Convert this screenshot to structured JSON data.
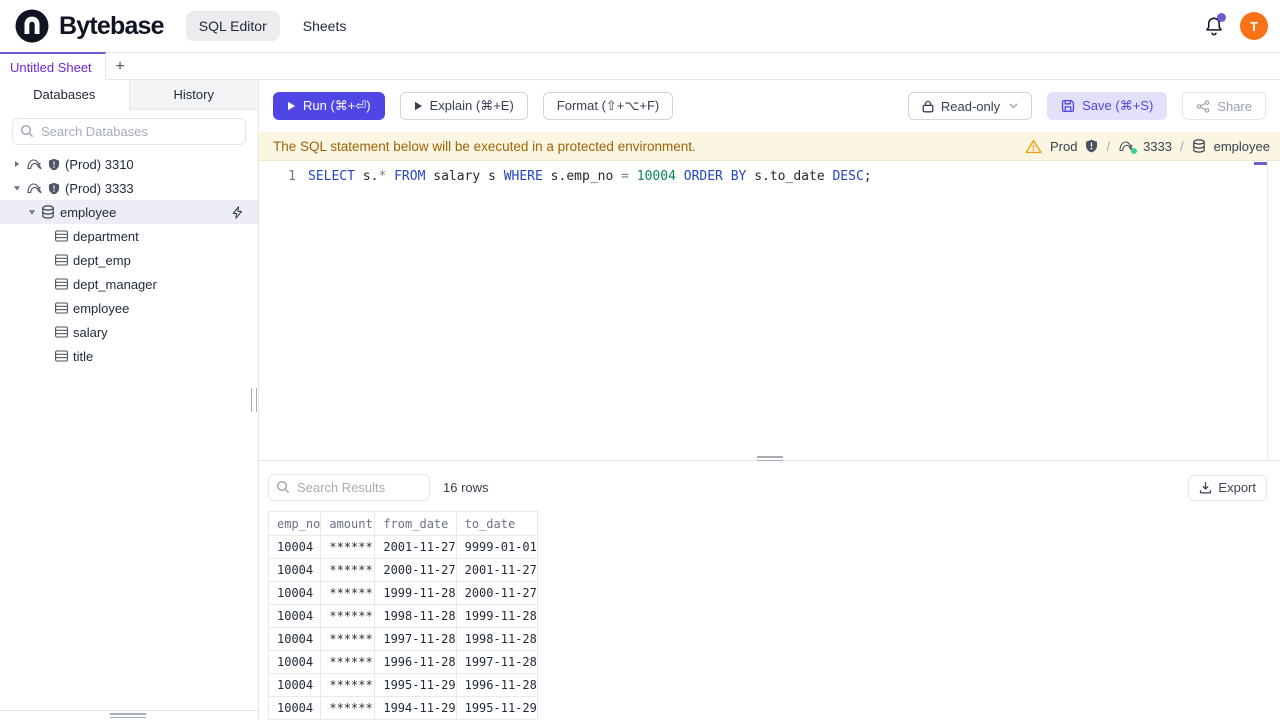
{
  "header": {
    "brand": "Bytebase",
    "tabs": [
      {
        "label": "SQL Editor",
        "active": true
      },
      {
        "label": "Sheets",
        "active": false
      }
    ],
    "avatar": "T"
  },
  "sheet_bar": {
    "active_tab": "Untitled Sheet",
    "add_button": "+"
  },
  "sidebar": {
    "tabs": [
      {
        "label": "Databases",
        "active": true
      },
      {
        "label": "History",
        "active": false
      }
    ],
    "search_placeholder": "Search Databases",
    "tree": [
      {
        "kind": "instance",
        "label": "(Prod) 3310",
        "caret": "collapsed"
      },
      {
        "kind": "instance",
        "label": "(Prod) 3333",
        "caret": "expanded"
      },
      {
        "kind": "database",
        "label": "employee",
        "caret": "expanded",
        "selected": true,
        "action_icon": "lightning-icon"
      },
      {
        "kind": "table",
        "label": "department"
      },
      {
        "kind": "table",
        "label": "dept_emp"
      },
      {
        "kind": "table",
        "label": "dept_manager"
      },
      {
        "kind": "table",
        "label": "employee"
      },
      {
        "kind": "table",
        "label": "salary"
      },
      {
        "kind": "table",
        "label": "title"
      }
    ]
  },
  "toolbar": {
    "run": "Run (⌘+⏎)",
    "explain": "Explain (⌘+E)",
    "format": "Format (⇧+⌥+F)",
    "readonly": "Read-only",
    "save": "Save (⌘+S)",
    "share": "Share"
  },
  "banner": {
    "message": "The SQL statement below will be executed in a protected environment.",
    "environment": "Prod",
    "separator": "/",
    "instance": "3333",
    "database": "employee"
  },
  "editor": {
    "line_number": "1",
    "sql_text": "SELECT s.* FROM salary s WHERE s.emp_no = 10004 ORDER BY s.to_date DESC;",
    "sql_tokens": [
      {
        "text": "SELECT",
        "type": "keyword"
      },
      {
        "text": " s.",
        "type": "plain"
      },
      {
        "text": "*",
        "type": "operator"
      },
      {
        "text": " ",
        "type": "plain"
      },
      {
        "text": "FROM",
        "type": "keyword"
      },
      {
        "text": " salary s ",
        "type": "plain"
      },
      {
        "text": "WHERE",
        "type": "keyword"
      },
      {
        "text": " s.emp_no ",
        "type": "plain"
      },
      {
        "text": "=",
        "type": "operator"
      },
      {
        "text": " ",
        "type": "plain"
      },
      {
        "text": "10004",
        "type": "number"
      },
      {
        "text": " ",
        "type": "plain"
      },
      {
        "text": "ORDER BY",
        "type": "keyword"
      },
      {
        "text": " s.to_date ",
        "type": "plain"
      },
      {
        "text": "DESC",
        "type": "keyword"
      },
      {
        "text": ";",
        "type": "plain"
      }
    ]
  },
  "results": {
    "search_placeholder": "Search Results",
    "row_count": "16 rows",
    "export": "Export",
    "table": {
      "columns": [
        "emp_no",
        "amount",
        "from_date",
        "to_date"
      ],
      "rows": [
        [
          "10004",
          "******",
          "2001-11-27",
          "9999-01-01"
        ],
        [
          "10004",
          "******",
          "2000-11-27",
          "2001-11-27"
        ],
        [
          "10004",
          "******",
          "1999-11-28",
          "2000-11-27"
        ],
        [
          "10004",
          "******",
          "1998-11-28",
          "1999-11-28"
        ],
        [
          "10004",
          "******",
          "1997-11-28",
          "1998-11-28"
        ],
        [
          "10004",
          "******",
          "1996-11-28",
          "1997-11-28"
        ],
        [
          "10004",
          "******",
          "1995-11-29",
          "1996-11-28"
        ],
        [
          "10004",
          "******",
          "1994-11-29",
          "1995-11-29"
        ]
      ]
    }
  },
  "colors": {
    "accent": "#4f46e5",
    "accent_light": "#e2e0fa",
    "tab_purple": "#6d5bd4",
    "tab_text": "#6d28d9",
    "keyword_blue": "#2445c5",
    "number_green": "#098658",
    "operator_gray": "#79818c",
    "warning_bg": "#fbf6e2",
    "warning_text": "#a16207",
    "avatar_orange": "#f97316",
    "status_green": "#34d399"
  }
}
